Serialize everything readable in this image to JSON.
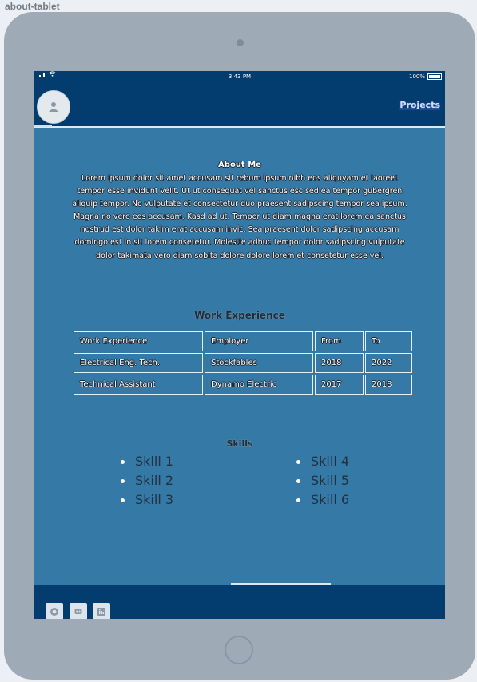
{
  "frame_label": "about-tablet",
  "status_bar": {
    "time": "3:43 PM",
    "battery": "100%"
  },
  "nav": {
    "avatar_icon": "person-icon",
    "projects_link": "Projects"
  },
  "about": {
    "title": "About Me",
    "body": "Lorem ipsum dolor sit amet accusam sit rebum ipsum nibh eos aliquyam et laoreet tempor esse invidunt velit. Ut ut consequat vel sanctus esc sed ea tempor gubergren aliquip tempor. No vulputate et consectetur duo praesent sadipscing tempor sea ipsum. Magna no vero eos accusam. Kasd ad ut. Tempor ut diam magna erat lorem ea sanctus nostrud est dolor takim erat accusam invic. Sea praesent dolor sadipscing accusam domingo est in sit lorem consetetur. Molestie adhuc tempor dolor sadipscing vulputate dolor takimata vero diam sobita dolore dolore lorem et consetetur esse vel."
  },
  "work": {
    "title": "Work Experience",
    "headers": [
      "Work Experience",
      "Employer",
      "From",
      "To"
    ],
    "rows": [
      [
        "Electrical Eng. Tech.",
        "Stockfables",
        "2018",
        "2022"
      ],
      [
        "Technical Assistant",
        "Dynamo Electric",
        "2017",
        "2018"
      ]
    ]
  },
  "skills": {
    "title": "Skills",
    "left": [
      "Skill 1",
      "Skill 2",
      "Skill 3"
    ],
    "right": [
      "Skill 4",
      "Skill 5",
      "Skill 6"
    ]
  },
  "footer": {
    "icons": [
      "github-icon",
      "discord-icon",
      "linkedin-icon"
    ]
  },
  "colors": {
    "bar": "#033d70",
    "content": "#357aa7",
    "device": "#9eaab6"
  }
}
